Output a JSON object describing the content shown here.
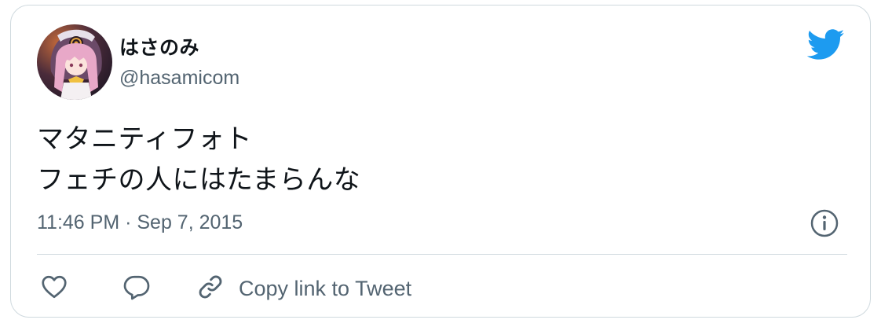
{
  "tweet": {
    "display_name": "はさのみ",
    "handle": "@hasamicom",
    "text": "マタニティフォト\nフェチの人にはたまらんな",
    "timestamp": "11:46 PM · Sep 7, 2015"
  },
  "actions": {
    "copy_link_label": "Copy link to Tweet"
  },
  "icons": {
    "brand": "twitter-bird-icon",
    "info": "info-icon",
    "like": "heart-icon",
    "reply": "speech-bubble-icon",
    "copy": "link-icon"
  },
  "colors": {
    "brand": "#1d9bf0",
    "text_primary": "#0f1419",
    "text_secondary": "#536471",
    "border": "#cfd9de"
  }
}
